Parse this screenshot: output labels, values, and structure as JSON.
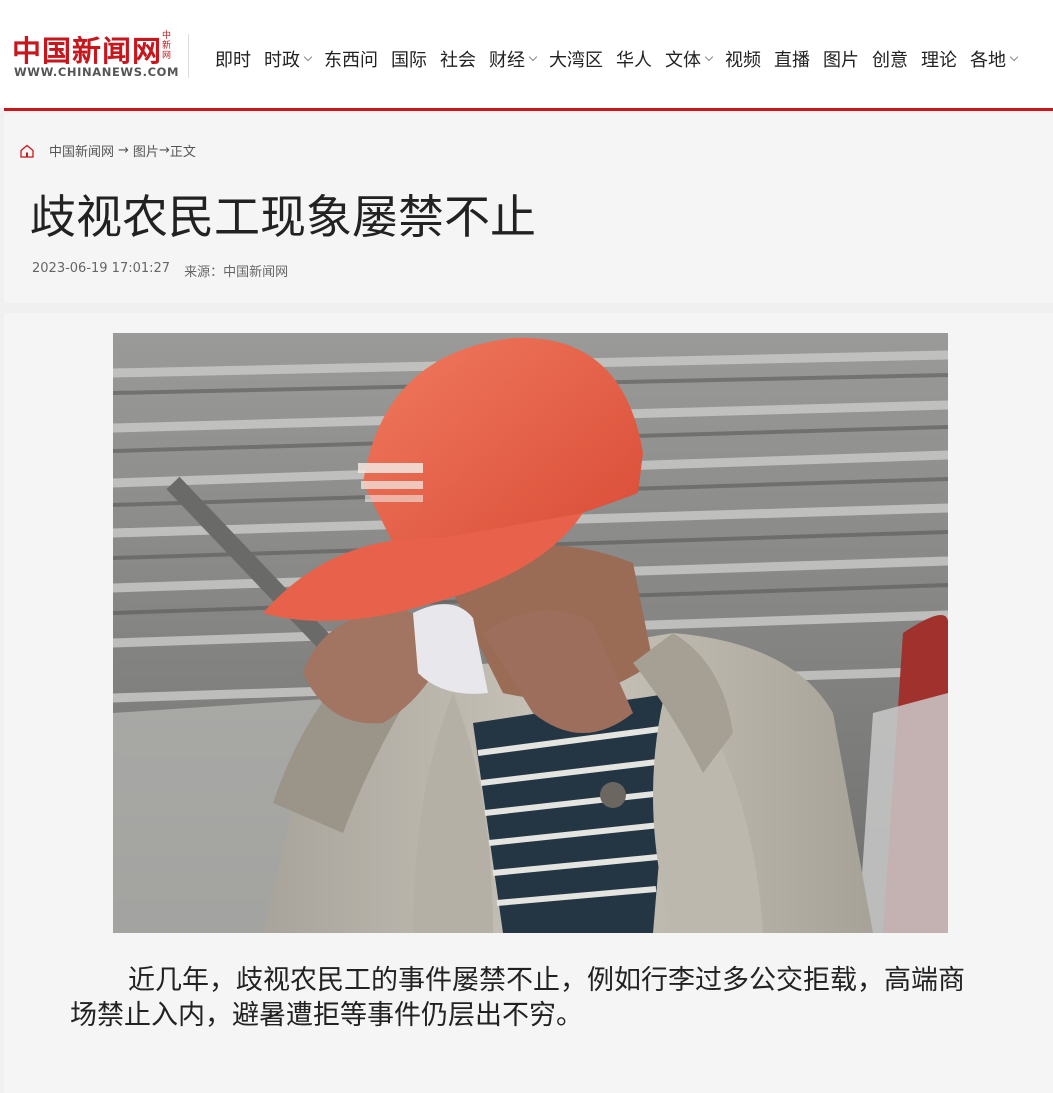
{
  "site": {
    "logo_cn": "中国新闻网",
    "logo_small": "中新网",
    "logo_en": "WWW.CHINANEWS.COM"
  },
  "nav": [
    {
      "label": "即时",
      "dropdown": false
    },
    {
      "label": "时政",
      "dropdown": true
    },
    {
      "label": "东西问",
      "dropdown": false
    },
    {
      "label": "国际",
      "dropdown": false
    },
    {
      "label": "社会",
      "dropdown": false
    },
    {
      "label": "财经",
      "dropdown": true
    },
    {
      "label": "大湾区",
      "dropdown": false
    },
    {
      "label": "华人",
      "dropdown": false
    },
    {
      "label": "文体",
      "dropdown": true
    },
    {
      "label": "视频",
      "dropdown": false
    },
    {
      "label": "直播",
      "dropdown": false
    },
    {
      "label": "图片",
      "dropdown": false
    },
    {
      "label": "创意",
      "dropdown": false
    },
    {
      "label": "理论",
      "dropdown": false
    },
    {
      "label": "各地",
      "dropdown": true
    }
  ],
  "breadcrumb": {
    "home": "中国新闻网",
    "arrow1": "→",
    "section": "图片",
    "arrow2": "→",
    "current": "正文"
  },
  "article": {
    "title": "歧视农民工现象屡禁不止",
    "datetime": "2023-06-19 17:01:27",
    "source_label": "来源：",
    "source": "中国新闻网",
    "caption": "近几年，歧视农民工的事件屡禁不止，例如行李过多公交拒载，高端商场禁止入内，避暑遭拒等事件仍层出不穷。"
  },
  "colors": {
    "brand_red": "#c8161d",
    "cap_red": "#e8553f"
  }
}
